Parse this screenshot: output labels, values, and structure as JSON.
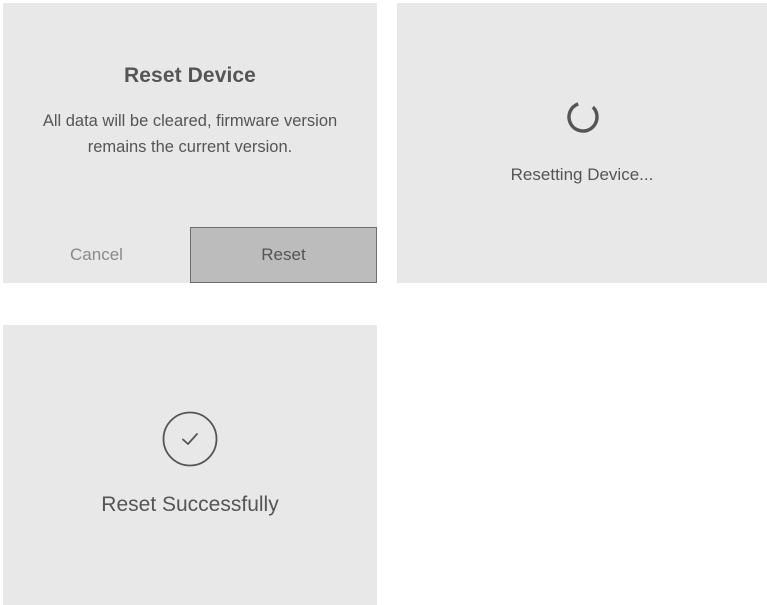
{
  "reset_dialog": {
    "title": "Reset Device",
    "message": "All data will be cleared, firmware version remains the current version.",
    "cancel_label": "Cancel",
    "reset_label": "Reset"
  },
  "resetting": {
    "icon": "spinner-icon",
    "status": "Resetting Device..."
  },
  "success": {
    "icon": "check-circle-icon",
    "status": "Reset Successfully"
  },
  "colors": {
    "panel_background": "#e8e8e8",
    "reset_button_background": "#bcbcbc",
    "text": "#555555",
    "muted_text": "#8a8a8a"
  }
}
